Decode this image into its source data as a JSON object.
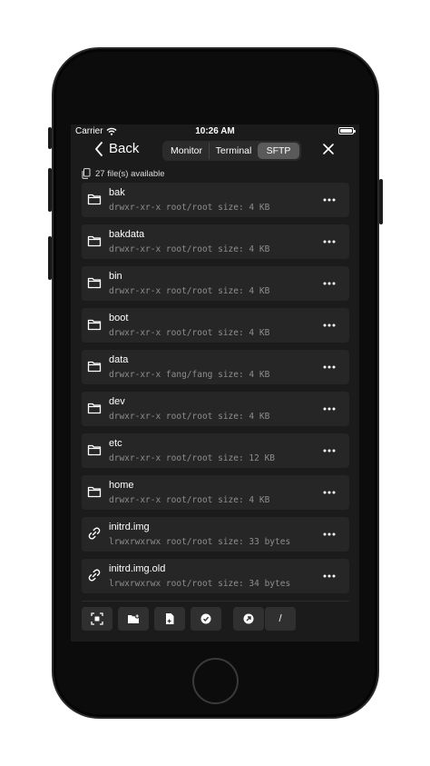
{
  "status_bar": {
    "carrier": "Carrier",
    "time": "10:26 AM"
  },
  "nav": {
    "back_label": "Back",
    "tabs": [
      {
        "label": "Monitor",
        "active": false
      },
      {
        "label": "Terminal",
        "active": false
      },
      {
        "label": "SFTP",
        "active": true
      }
    ]
  },
  "file_count": "27 file(s) available",
  "files": [
    {
      "name": "bak",
      "meta": "drwxr-xr-x root/root size: 4 KB",
      "icon": "folder-icon"
    },
    {
      "name": "bakdata",
      "meta": "drwxr-xr-x root/root size: 4 KB",
      "icon": "folder-icon"
    },
    {
      "name": "bin",
      "meta": "drwxr-xr-x root/root size: 4 KB",
      "icon": "folder-icon"
    },
    {
      "name": "boot",
      "meta": "drwxr-xr-x root/root size: 4 KB",
      "icon": "folder-icon"
    },
    {
      "name": "data",
      "meta": "drwxr-xr-x fang/fang size: 4 KB",
      "icon": "folder-icon"
    },
    {
      "name": "dev",
      "meta": "drwxr-xr-x root/root size: 4 KB",
      "icon": "folder-icon"
    },
    {
      "name": "etc",
      "meta": "drwxr-xr-x root/root size: 12 KB",
      "icon": "folder-icon"
    },
    {
      "name": "home",
      "meta": "drwxr-xr-x root/root size: 4 KB",
      "icon": "folder-icon"
    },
    {
      "name": "initrd.img",
      "meta": "lrwxrwxrwx root/root size: 33 bytes",
      "icon": "link-icon"
    },
    {
      "name": "initrd.img.old",
      "meta": "lrwxrwxrwx root/root size: 34 bytes",
      "icon": "link-icon"
    }
  ],
  "toolbar": {
    "buttons": [
      {
        "icon": "scan-icon"
      },
      {
        "icon": "new-folder-icon"
      },
      {
        "icon": "new-file-icon"
      },
      {
        "icon": "check-circle-icon"
      },
      {
        "icon": "arrow-circle-icon"
      }
    ],
    "path_label": "/"
  },
  "colors": {
    "background": "#1b1b1b",
    "row": "#262626",
    "active_tab": "#5a5a5a"
  }
}
